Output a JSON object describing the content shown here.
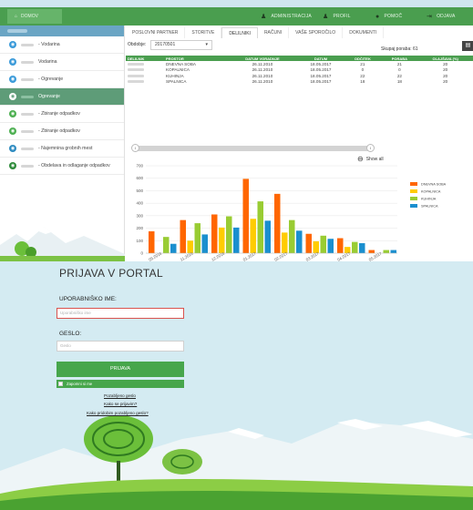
{
  "app": {
    "home_label": "DOMOV",
    "nav": [
      {
        "label": "ADMINISTRACIJA",
        "icon": "user-icon"
      },
      {
        "label": "PROFIL",
        "icon": "user-icon"
      },
      {
        "label": "POMOČ",
        "icon": "help-icon"
      },
      {
        "label": "ODJAVA",
        "icon": "logout-icon"
      }
    ],
    "sidebar": {
      "items": [
        {
          "label": "- Vodarina",
          "color": "#3a9ad9",
          "active": false
        },
        {
          "label": "Vodarina",
          "color": "#3a9ad9",
          "active": false
        },
        {
          "label": "- Ogrevanje",
          "color": "#3a9ad9",
          "active": false
        },
        {
          "label": "Ogrevanje",
          "color": "#3a9ad9",
          "active": true
        },
        {
          "label": "- Zbiranje odpadkov",
          "color": "#4caf50",
          "active": false
        },
        {
          "label": "- Zbiranje odpadkov",
          "color": "#4caf50",
          "active": false
        },
        {
          "label": "- Najemnina grobnih mest",
          "color": "#2e8bc0",
          "active": false
        },
        {
          "label": "- Obdelava in odlaganje odpadkov",
          "color": "#2e8b3a",
          "active": false
        }
      ]
    },
    "tabs": [
      "POSLOVNI PARTNER",
      "STORITVE",
      "DELILNIKI",
      "RAČUNI",
      "VAŠE SPOROČILO",
      "DOKUMENTI"
    ],
    "active_tab": 2,
    "filter": {
      "label": "Obdobje:",
      "value": "20170501"
    },
    "total": "Skupaj poraba: 61",
    "table": {
      "headers": [
        "DELILNIK",
        "PROSTOR",
        "DATUM VGRADNJE",
        "DATUM",
        "ODČITEK",
        "PORABA",
        "OLAJŠAVA (%)"
      ],
      "rows": [
        [
          "DNEVNA SOBA",
          "26.11.2010",
          "18.05.2017",
          "21",
          "21",
          "20"
        ],
        [
          "KOPALNICA",
          "26.11.2010",
          "18.05.2017",
          "0",
          "0",
          "20"
        ],
        [
          "KUHINJA",
          "26.11.2010",
          "18.05.2017",
          "22",
          "22",
          "20"
        ],
        [
          "SPALNICA",
          "26.11.2010",
          "18.05.2017",
          "18",
          "18",
          "20"
        ]
      ]
    },
    "show_all": "Show all"
  },
  "chart_data": {
    "type": "bar",
    "categories": [
      "05.2016",
      "11.2016",
      "12.2016",
      "01.2017",
      "02.2017",
      "03.2017",
      "04.2017",
      "05.2017"
    ],
    "x_tick_labels": [
      "05.2016",
      "11.2016",
      "12.2016",
      "01.2017",
      "02.2017",
      "03.2017",
      "04.2017",
      "05.2017"
    ],
    "series": [
      {
        "name": "DNEVNA SOBA",
        "color": "#ff6600",
        "values": [
          175,
          265,
          310,
          595,
          475,
          155,
          120,
          25
        ]
      },
      {
        "name": "KOPALNICA",
        "color": "#ffcc00",
        "values": [
          0,
          100,
          205,
          275,
          165,
          95,
          50,
          0
        ]
      },
      {
        "name": "KUHINJA",
        "color": "#99cc33",
        "values": [
          130,
          240,
          295,
          415,
          265,
          140,
          90,
          25
        ]
      },
      {
        "name": "SPALNICA",
        "color": "#1a8fcf",
        "values": [
          75,
          150,
          205,
          260,
          180,
          115,
          80,
          25
        ]
      }
    ],
    "yticks": [
      0,
      100,
      200,
      300,
      400,
      500,
      600,
      700
    ],
    "ylim": [
      0,
      700
    ],
    "legend_position": "right"
  },
  "login": {
    "title": "PRIJAVA V PORTAL",
    "username_label": "UPORABNIŠKO IME:",
    "username_placeholder": "Uporabniško ime",
    "password_label": "GESLO:",
    "password_placeholder": "Geslo",
    "submit": "PRIJAVA",
    "remember": "Zapomni si me",
    "links": [
      "Pozabljeno geslo",
      "Kako se prijavim?",
      "Kako pridobim pozabljeno geslo?"
    ]
  }
}
